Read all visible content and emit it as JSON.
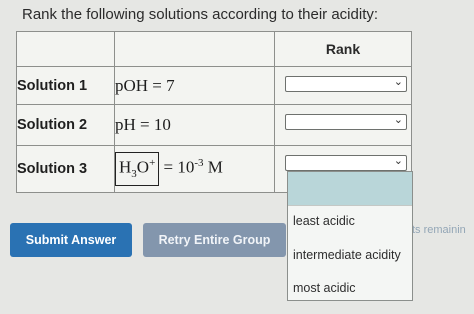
{
  "prompt": "Rank the following solutions according to their acidity:",
  "table": {
    "rank_header": "Rank",
    "rows": [
      {
        "label": "Solution 1",
        "value_parts": [
          "pOH = 7"
        ]
      },
      {
        "label": "Solution 2",
        "value_parts": [
          "pH = 10"
        ]
      },
      {
        "label": "Solution 3",
        "value_parts": [
          "H",
          "3",
          "O",
          "+",
          "= 10",
          "-3",
          " M"
        ]
      }
    ]
  },
  "dropdown": {
    "selected_values": [
      "",
      "",
      ""
    ],
    "options": [
      "least acidic",
      "intermediate acidity",
      "most acidic"
    ],
    "highlight_color": "#b9d6d9"
  },
  "buttons": {
    "submit_label": "Submit Answer",
    "retry_label": "Retry Entire Group"
  },
  "remaining_text": "ts remainin",
  "colors": {
    "submit": "#2a72b3",
    "retry": "#8396ad"
  },
  "icons": {
    "select_arrow": "chevron-down-icon"
  }
}
